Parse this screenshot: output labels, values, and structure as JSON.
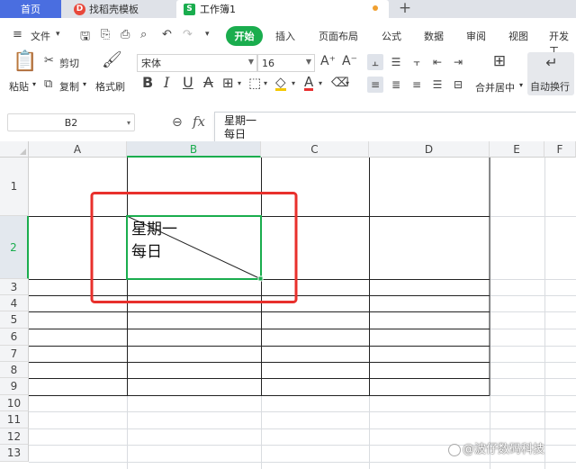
{
  "tabs": {
    "home": "首页",
    "doc": "找稻壳模板",
    "doc_logo": "D",
    "active": "工作簿1",
    "active_logo": "S",
    "add": "+"
  },
  "menu": {
    "file": "文件",
    "start": "开始",
    "items": [
      "插入",
      "页面布局",
      "公式",
      "数据",
      "审阅",
      "视图",
      "开发工"
    ]
  },
  "ribbon": {
    "paste": "粘贴",
    "cut": "剪切",
    "copy": "复制",
    "format_painter": "格式刷",
    "font_name": "宋体",
    "font_size": "16",
    "bold": "B",
    "italic": "I",
    "underline": "U",
    "strike": "A",
    "font_color_glyph": "A",
    "merge_center": "合并居中",
    "wrap_text": "自动换行"
  },
  "formula_bar": {
    "name_box": "B2",
    "fx": "fx",
    "content_line1": "星期一",
    "content_line2": "每日"
  },
  "grid": {
    "columns": [
      "A",
      "B",
      "C",
      "D",
      "E",
      "F"
    ],
    "rows": [
      "1",
      "2",
      "3",
      "4",
      "5",
      "6",
      "7",
      "8",
      "9",
      "10",
      "11",
      "12",
      "13"
    ],
    "selected_cell": "B2",
    "cell_b2_line1": "星期一",
    "cell_b2_line2": "每日"
  },
  "watermark": "@波仔数码科技",
  "colors": {
    "accent_green": "#1aad4e",
    "home_tab": "#4a6ee0",
    "highlight_box": "#e8302c"
  }
}
